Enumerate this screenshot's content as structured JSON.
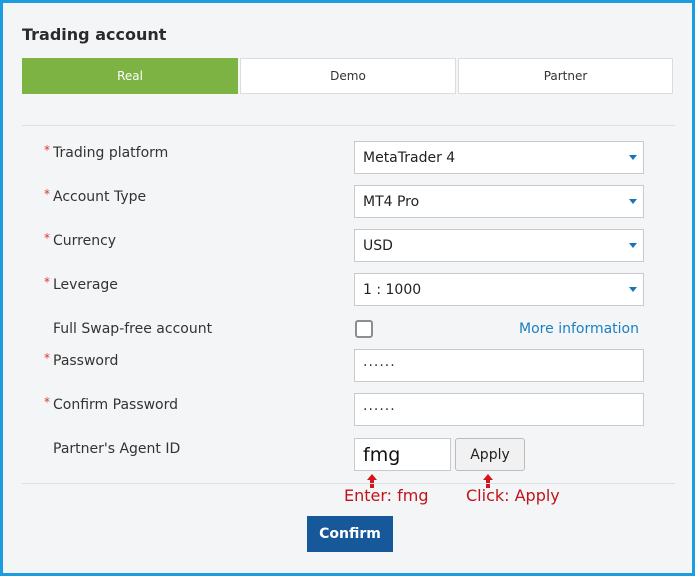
{
  "title": "Trading account",
  "tabs": [
    {
      "label": "Real",
      "active": true
    },
    {
      "label": "Demo",
      "active": false
    },
    {
      "label": "Partner",
      "active": false
    }
  ],
  "form": {
    "platform": {
      "label": "Trading platform",
      "required": "*",
      "value": "MetaTrader 4"
    },
    "account_type": {
      "label": "Account Type",
      "required": "*",
      "value": "MT4 Pro"
    },
    "currency": {
      "label": "Currency",
      "required": "*",
      "value": "USD"
    },
    "leverage": {
      "label": "Leverage",
      "required": "*",
      "value": "1 : 1000"
    },
    "swap_free": {
      "label": "Full Swap-free account",
      "checked": false,
      "link": "More information"
    },
    "password": {
      "label": "Password",
      "required": "*",
      "value": "······"
    },
    "confirm_password": {
      "label": "Confirm Password",
      "required": "*",
      "value": "······"
    },
    "agent_id": {
      "label": "Partner's Agent ID",
      "value": "fmg",
      "apply_label": "Apply"
    }
  },
  "annotations": {
    "enter": "Enter: fmg",
    "click": "Click: Apply"
  },
  "confirm_label": "Confirm",
  "colors": {
    "frame_border": "#1a9ee0",
    "tab_active": "#7cb342",
    "required": "#d9352e",
    "link": "#1a80c4",
    "confirm_bg": "#17589a",
    "annotation": "#c0141b"
  }
}
